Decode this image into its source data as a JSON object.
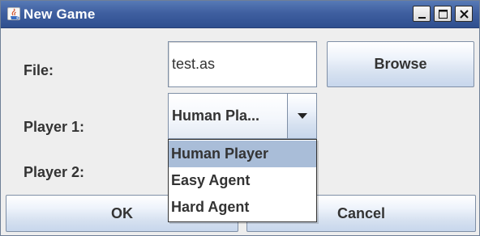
{
  "window": {
    "title": "New Game",
    "icon": "java-cup-icon",
    "buttons": {
      "minimize_icon": "minimize-icon",
      "maximize_icon": "maximize-icon",
      "close_icon": "close-icon"
    }
  },
  "form": {
    "file_label": "File:",
    "file_value": "test.as",
    "browse_label": "Browse",
    "player1_label": "Player 1:",
    "player1_selected": "Human Pla...",
    "player2_label": "Player 2:"
  },
  "dropdown": {
    "arrow_icon": "triangle-down-icon",
    "options": [
      "Human Player",
      "Easy Agent",
      "Hard Agent"
    ],
    "highlighted_index": 0
  },
  "actions": {
    "ok_label": "OK",
    "cancel_label": "Cancel"
  },
  "colors": {
    "titlebar": "#3f5fa0",
    "highlight": "#a9bdd8",
    "background": "#eeeeee"
  }
}
